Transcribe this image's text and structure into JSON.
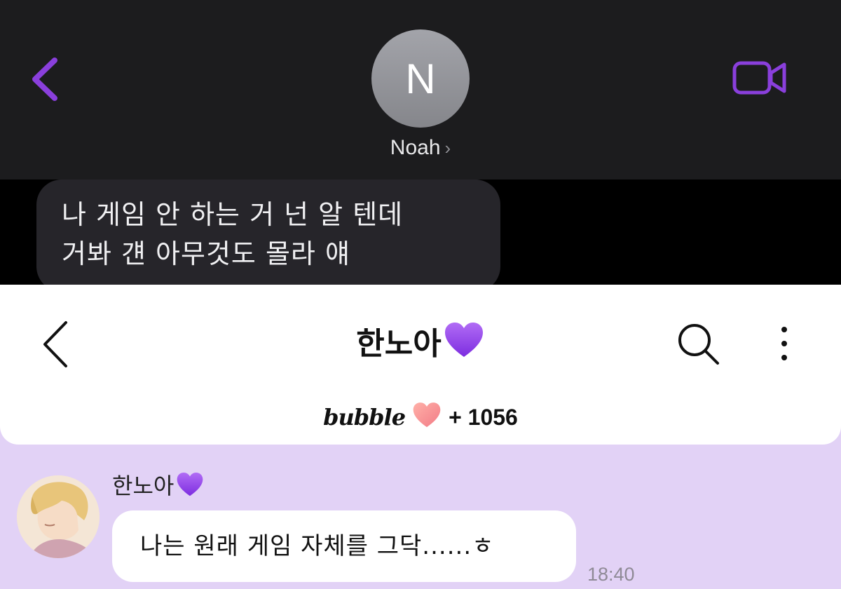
{
  "imessage": {
    "contact_initial": "N",
    "contact_name": "Noah",
    "name_chevron": "›",
    "back_icon": "chevron-left-icon",
    "video_icon": "video-camera-icon",
    "accent_color": "#8a3fdc",
    "message_lines": [
      "나 게임 안 하는 거 넌 알 텐데",
      "거봐 걘 아무것도 몰라 얘"
    ]
  },
  "bubble_app": {
    "title": "한노아",
    "title_emoji_icon": "purple-heart-icon",
    "brand": "bubble",
    "brand_heart_icon": "pink-heart-icon",
    "count_text": "+ 1056",
    "search_icon": "search-icon",
    "more_icon": "more-vertical-icon",
    "background_color": "#e2d2f6",
    "sender_name": "한노아",
    "message_text": "나는 원래 게임 자체를 그닥......ㅎ",
    "time": "18:40"
  }
}
